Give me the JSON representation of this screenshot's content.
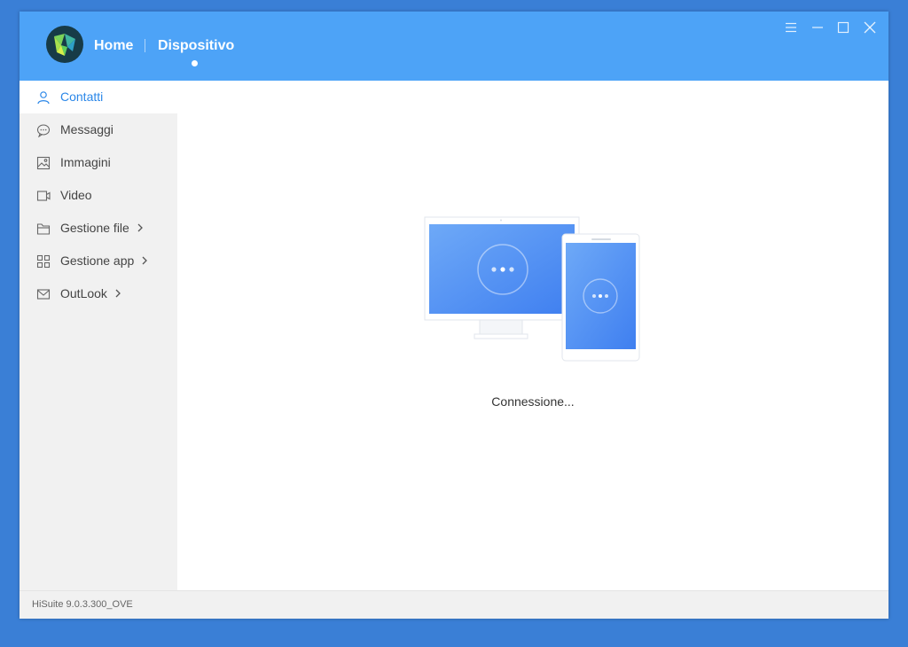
{
  "header": {
    "nav_home": "Home",
    "nav_device": "Dispositivo"
  },
  "window_controls": [
    {
      "icon": "menu-icon"
    },
    {
      "icon": "minimize-icon"
    },
    {
      "icon": "maximize-icon"
    },
    {
      "icon": "close-icon"
    }
  ],
  "sidebar": {
    "items": [
      {
        "label": "Contatti",
        "icon": "person-icon",
        "active": true
      },
      {
        "label": "Messaggi",
        "icon": "chat-icon"
      },
      {
        "label": "Immagini",
        "icon": "image-icon"
      },
      {
        "label": "Video",
        "icon": "video-icon"
      },
      {
        "label": "Gestione file",
        "icon": "folder-icon",
        "has_submenu": true
      },
      {
        "label": "Gestione app",
        "icon": "apps-grid-icon",
        "has_submenu": true
      },
      {
        "label": "OutLook",
        "icon": "mail-icon",
        "has_submenu": true
      }
    ]
  },
  "main": {
    "status_text": "Connessione..."
  },
  "footer": {
    "version": "HiSuite 9.0.3.300_OVE"
  },
  "colors": {
    "titlebar": "#4da3f7",
    "accent": "#2b87e8",
    "desktop": "#3a7fd6"
  }
}
